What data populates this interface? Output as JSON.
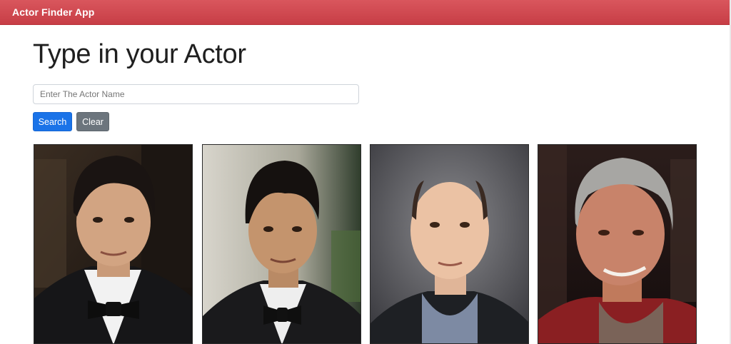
{
  "navbar": {
    "brand": "Actor Finder App"
  },
  "page": {
    "title": "Type in your Actor"
  },
  "search": {
    "placeholder": "Enter The Actor Name",
    "value": ""
  },
  "buttons": {
    "search_label": "Search",
    "clear_label": "Clear"
  },
  "colors": {
    "navbar": "#c9434a",
    "search_button": "#1a73e8",
    "clear_button": "#6c757d"
  },
  "cards": [
    {
      "photo": "actor-photo-1"
    },
    {
      "photo": "actor-photo-2"
    },
    {
      "photo": "actor-photo-3"
    },
    {
      "photo": "actor-photo-4"
    }
  ]
}
